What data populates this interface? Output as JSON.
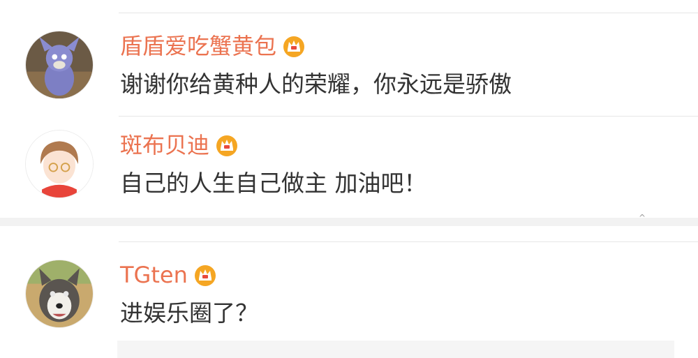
{
  "comments": [
    {
      "username": "盾盾爱吃蟹黄包",
      "text": "谢谢你给黄种人的荣耀，你永远是骄傲"
    },
    {
      "username": "斑布贝迪",
      "text": "自己的人生自己做主  加油吧！"
    },
    {
      "username": "TGten",
      "text": "进娱乐圈了？"
    }
  ],
  "colors": {
    "username": "#eb7350",
    "text": "#333333",
    "crown": "#f5a623"
  },
  "icons": {
    "crown": "crown-vip-icon",
    "caret": "caret-up-icon"
  }
}
